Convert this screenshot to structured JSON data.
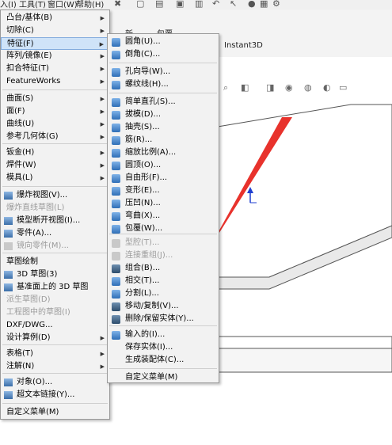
{
  "top_menu": [
    "入(I)",
    "工具(T)",
    "窗口(W)",
    "帮助(H)"
  ],
  "ribbon": {
    "tab1": "新",
    "tab2": "包覆",
    "tab3": "Instant3D"
  },
  "main_menu": {
    "items": [
      {
        "label": "凸台/基体(B)",
        "arrow": "▶"
      },
      {
        "label": "切除(C)",
        "arrow": "▶"
      },
      {
        "label": "特征(F)",
        "arrow": "▶"
      },
      {
        "label": "阵列/镜像(E)",
        "arrow": "▶"
      },
      {
        "label": "扣合特征(T)",
        "arrow": "▶"
      },
      {
        "label": "FeatureWorks",
        "arrow": "▶"
      },
      {
        "label": "曲面(S)",
        "arrow": "▶"
      },
      {
        "label": "面(F)",
        "arrow": "▶"
      },
      {
        "label": "曲线(U)",
        "arrow": "▶"
      },
      {
        "label": "参考几何体(G)",
        "arrow": "▶"
      },
      {
        "label": "钣金(H)",
        "arrow": "▶"
      },
      {
        "label": "焊件(W)",
        "arrow": "▶"
      },
      {
        "label": "模具(L)",
        "arrow": "▶"
      },
      {
        "label": "爆炸视图(V)..."
      },
      {
        "label": "爆炸直线草图(L)"
      },
      {
        "label": "模型断开视图(I)..."
      },
      {
        "label": "零件(A)..."
      },
      {
        "label": "镜向零件(M)..."
      },
      {
        "label": "草图绘制"
      },
      {
        "label": "3D 草图(3)"
      },
      {
        "label": "基准面上的 3D 草图"
      },
      {
        "label": "派生草图(D)"
      },
      {
        "label": "工程图中的草图(I)"
      },
      {
        "label": "DXF/DWG..."
      },
      {
        "label": "设计算例(D)",
        "arrow": "▶"
      },
      {
        "label": "表格(T)",
        "arrow": "▶"
      },
      {
        "label": "注解(N)",
        "arrow": "▶"
      },
      {
        "label": "对象(O)..."
      },
      {
        "label": "超文本链接(Y)..."
      },
      {
        "label": "自定义菜单(M)"
      }
    ]
  },
  "sub_menu": {
    "items": [
      {
        "label": "圆角(U)...",
        "icon": "fillet-icon"
      },
      {
        "label": "倒角(C)...",
        "icon": "chamfer-icon"
      },
      {
        "label": "孔向导(W)...",
        "icon": "hole-wizard-icon"
      },
      {
        "label": "螺纹线(H)...",
        "icon": "thread-icon"
      },
      {
        "label": "简单直孔(S)...",
        "icon": "simple-hole-icon"
      },
      {
        "label": "拔模(D)...",
        "icon": "draft-icon"
      },
      {
        "label": "抽壳(S)...",
        "icon": "shell-icon"
      },
      {
        "label": "筋(R)...",
        "icon": "rib-icon"
      },
      {
        "label": "缩放比例(A)...",
        "icon": "scale-icon"
      },
      {
        "label": "圆顶(O)...",
        "icon": "dome-icon"
      },
      {
        "label": "自由形(F)...",
        "icon": "freeform-icon"
      },
      {
        "label": "变形(E)...",
        "icon": "deform-icon"
      },
      {
        "label": "压凹(N)...",
        "icon": "indent-icon"
      },
      {
        "label": "弯曲(X)...",
        "icon": "flex-icon"
      },
      {
        "label": "包覆(W)...",
        "icon": "wrap-icon"
      },
      {
        "label": "型腔(T)...",
        "icon": "cavity-icon"
      },
      {
        "label": "连接重组(J)...",
        "icon": "join-icon"
      },
      {
        "label": "组合(B)...",
        "icon": "combine-icon"
      },
      {
        "label": "相交(T)...",
        "icon": "intersect-icon"
      },
      {
        "label": "分割(L)...",
        "icon": "split-icon"
      },
      {
        "label": "移动/复制(V)...",
        "icon": "move-copy-icon"
      },
      {
        "label": "删除/保留实体(Y)...",
        "icon": "delete-body-icon"
      },
      {
        "label": "输入的(I)...",
        "icon": "imported-icon"
      },
      {
        "label": "保存实体(I)...",
        "icon": "none"
      },
      {
        "label": "生成装配体(C)...",
        "icon": "none"
      },
      {
        "label": "自定义菜单(M)",
        "icon": "none"
      }
    ]
  },
  "colors": {
    "highlight": "#cfe3f8",
    "annotation_arrow": "#e8322c",
    "axis": "#1f3fd0"
  }
}
